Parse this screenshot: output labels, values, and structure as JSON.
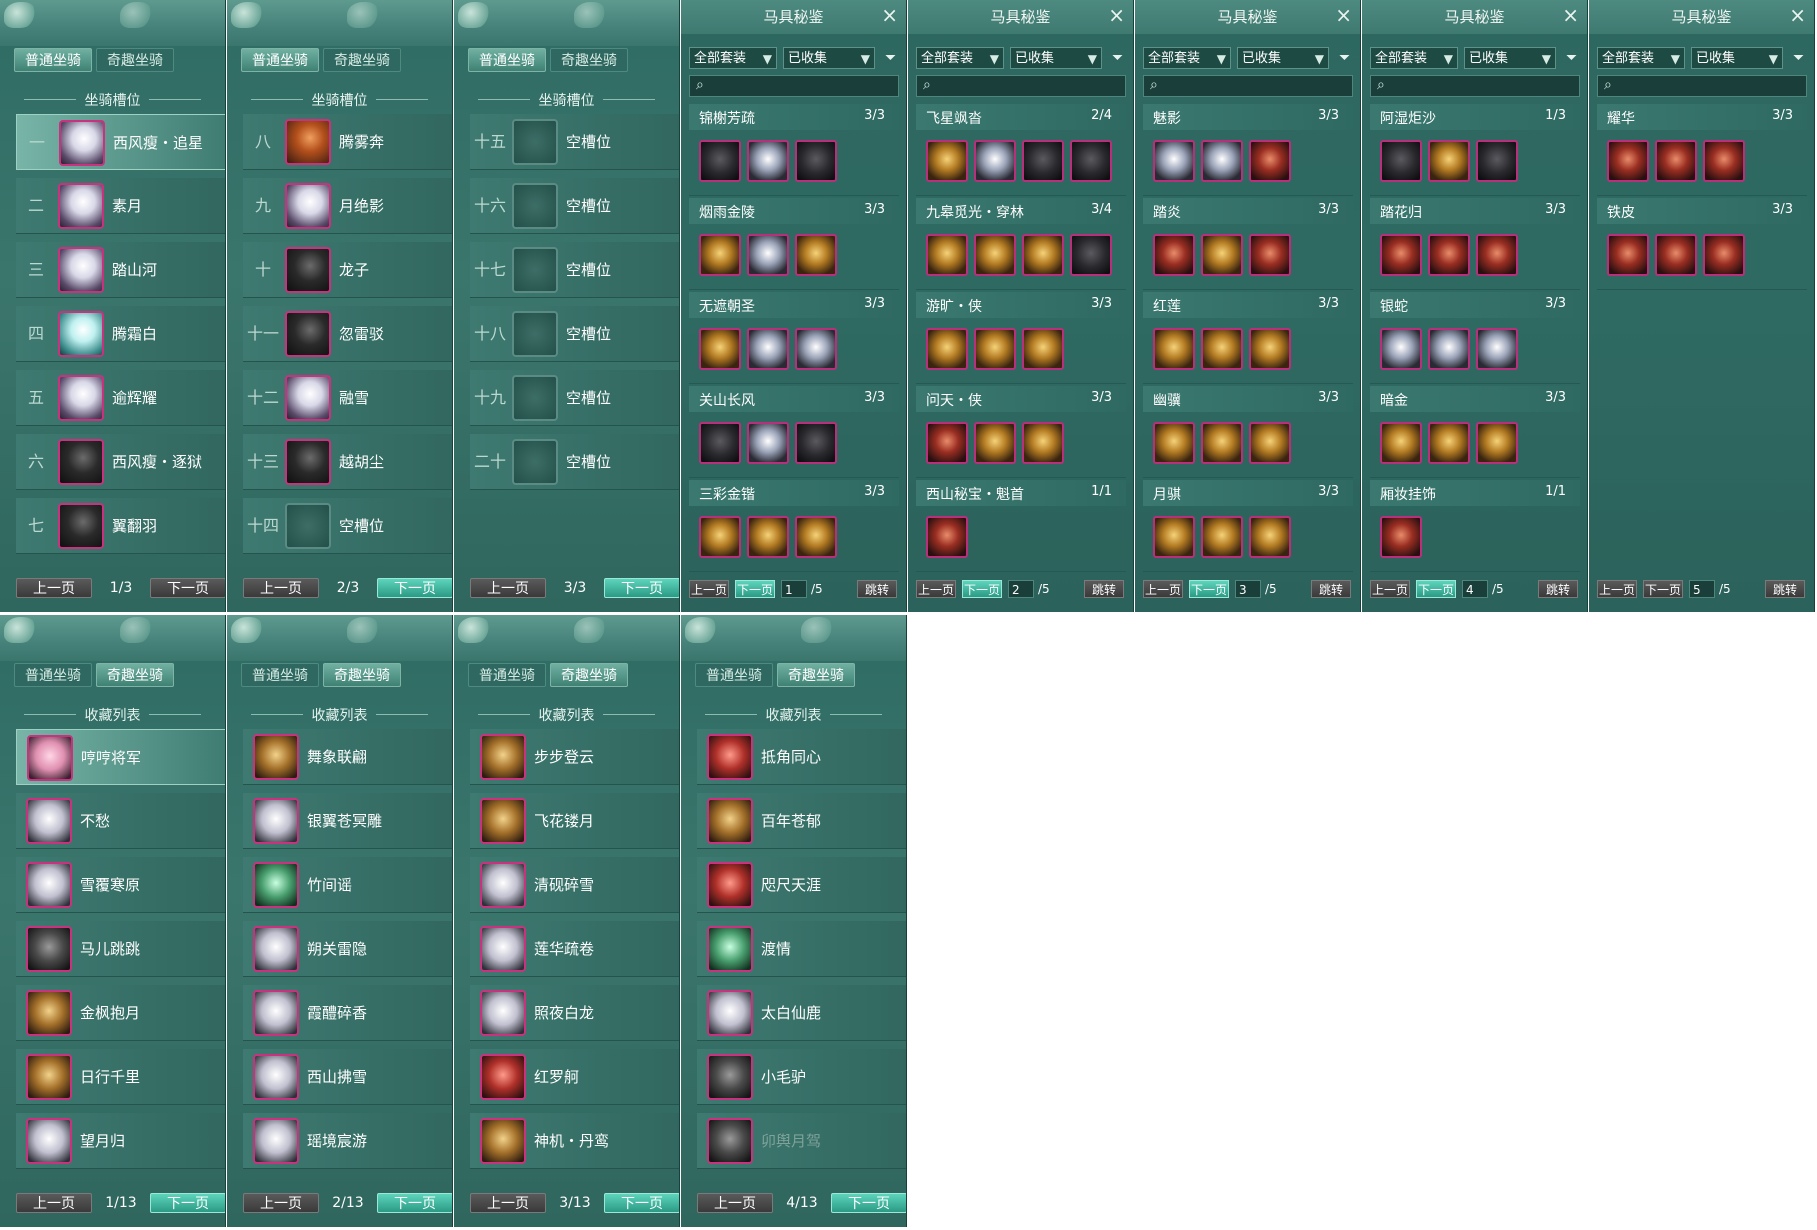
{
  "mount_tabs": {
    "normal": "普通坐骑",
    "fun": "奇趣坐骑"
  },
  "slots_title": "坐骑槽位",
  "collect_title": "收藏列表",
  "pager": {
    "prev": "上一页",
    "next": "下一页"
  },
  "mount_pages": [
    {
      "page": "1/3",
      "slots": [
        {
          "num": "一",
          "name": "西风瘦・追星",
          "thumb": "white",
          "selected": true
        },
        {
          "num": "二",
          "name": "素月",
          "thumb": "white"
        },
        {
          "num": "三",
          "name": "踏山河",
          "thumb": "white"
        },
        {
          "num": "四",
          "name": "腾霜白",
          "thumb": "cyan"
        },
        {
          "num": "五",
          "name": "逾辉耀",
          "thumb": "white"
        },
        {
          "num": "六",
          "name": "西风瘦・逐狱",
          "thumb": "dark"
        },
        {
          "num": "七",
          "name": "翼翻羽",
          "thumb": "dark"
        }
      ]
    },
    {
      "page": "2/3",
      "slots": [
        {
          "num": "八",
          "name": "腾雾奔",
          "thumb": "red"
        },
        {
          "num": "九",
          "name": "月绝影",
          "thumb": "white"
        },
        {
          "num": "十",
          "name": "龙子",
          "thumb": "dark"
        },
        {
          "num": "十一",
          "name": "忽雷驳",
          "thumb": "dark"
        },
        {
          "num": "十二",
          "name": "融雪",
          "thumb": "white"
        },
        {
          "num": "十三",
          "name": "越胡尘",
          "thumb": "dark"
        },
        {
          "num": "十四",
          "name": "空槽位",
          "thumb": "empty"
        }
      ]
    },
    {
      "page": "3/3",
      "slots": [
        {
          "num": "十五",
          "name": "空槽位",
          "thumb": "empty"
        },
        {
          "num": "十六",
          "name": "空槽位",
          "thumb": "empty"
        },
        {
          "num": "十七",
          "name": "空槽位",
          "thumb": "empty"
        },
        {
          "num": "十八",
          "name": "空槽位",
          "thumb": "empty"
        },
        {
          "num": "十九",
          "name": "空槽位",
          "thumb": "empty"
        },
        {
          "num": "二十",
          "name": "空槽位",
          "thumb": "empty"
        }
      ]
    }
  ],
  "collection": {
    "title": "马具秘鉴",
    "close": "×",
    "filter_all": "全部套装",
    "filter_collected": "已收集",
    "jump": "跳转",
    "total": "/5",
    "pages": [
      {
        "page": "1",
        "sets": [
          {
            "name": "锦榭芳疏",
            "count": "3/3",
            "pieces": [
              "dark",
              "silver",
              "dark"
            ]
          },
          {
            "name": "烟雨金陵",
            "count": "3/3",
            "pieces": [
              "gold",
              "silver",
              "gold"
            ]
          },
          {
            "name": "无遮朝圣",
            "count": "3/3",
            "pieces": [
              "gold",
              "silver",
              "silver"
            ]
          },
          {
            "name": "关山长风",
            "count": "3/3",
            "pieces": [
              "dark",
              "silver",
              "dark"
            ]
          },
          {
            "name": "三彩金锴",
            "count": "3/3",
            "pieces": [
              "gold",
              "gold",
              "gold"
            ]
          }
        ]
      },
      {
        "page": "2",
        "sets": [
          {
            "name": "飞星飒沓",
            "count": "2/4",
            "pieces": [
              "gold",
              "silver",
              "dark",
              "dark"
            ]
          },
          {
            "name": "九皋觅光・穿林",
            "count": "3/4",
            "pieces": [
              "gold",
              "gold",
              "gold",
              "dark"
            ]
          },
          {
            "name": "游旷・侠",
            "count": "3/3",
            "pieces": [
              "gold",
              "gold",
              "gold"
            ]
          },
          {
            "name": "问天・侠",
            "count": "3/3",
            "pieces": [
              "red",
              "gold",
              "gold"
            ]
          },
          {
            "name": "西山秘宝・魁首",
            "count": "1/1",
            "pieces": [
              "red"
            ]
          }
        ]
      },
      {
        "page": "3",
        "sets": [
          {
            "name": "魅影",
            "count": "3/3",
            "pieces": [
              "silver",
              "silver",
              "red"
            ]
          },
          {
            "name": "踏炎",
            "count": "3/3",
            "pieces": [
              "red",
              "gold",
              "red"
            ]
          },
          {
            "name": "红莲",
            "count": "3/3",
            "pieces": [
              "gold",
              "gold",
              "gold"
            ]
          },
          {
            "name": "幽骥",
            "count": "3/3",
            "pieces": [
              "gold",
              "gold",
              "gold"
            ]
          },
          {
            "name": "月骐",
            "count": "3/3",
            "pieces": [
              "gold",
              "gold",
              "gold"
            ]
          }
        ]
      },
      {
        "page": "4",
        "sets": [
          {
            "name": "阿湿炬沙",
            "count": "1/3",
            "pieces": [
              "dark",
              "gold",
              "dark"
            ]
          },
          {
            "name": "踏花归",
            "count": "3/3",
            "pieces": [
              "red",
              "red",
              "red"
            ]
          },
          {
            "name": "银蛇",
            "count": "3/3",
            "pieces": [
              "silver",
              "silver",
              "silver"
            ]
          },
          {
            "name": "暗金",
            "count": "3/3",
            "pieces": [
              "gold",
              "gold",
              "gold"
            ]
          },
          {
            "name": "厢妆挂饰",
            "count": "1/1",
            "pieces": [
              "red"
            ]
          }
        ]
      },
      {
        "page": "5",
        "sets": [
          {
            "name": "耀华",
            "count": "3/3",
            "pieces": [
              "red",
              "red",
              "red"
            ]
          },
          {
            "name": "铁皮",
            "count": "3/3",
            "pieces": [
              "red",
              "red",
              "red"
            ]
          }
        ]
      }
    ]
  },
  "fun_pages": [
    {
      "page": "1/13",
      "items": [
        {
          "name": "哼哼将军",
          "thumb": "t1",
          "selected": true
        },
        {
          "name": "不愁",
          "thumb": "t2"
        },
        {
          "name": "雪覆寒原",
          "thumb": "t2"
        },
        {
          "name": "马儿跳跳",
          "thumb": "t6"
        },
        {
          "name": "金枫抱月",
          "thumb": "t3"
        },
        {
          "name": "日行千里",
          "thumb": "t3"
        },
        {
          "name": "望月归",
          "thumb": "t2"
        }
      ]
    },
    {
      "page": "2/13",
      "items": [
        {
          "name": "舞象联翩",
          "thumb": "t3"
        },
        {
          "name": "银翼苍冥雕",
          "thumb": "t2"
        },
        {
          "name": "竹间谣",
          "thumb": "t4"
        },
        {
          "name": "朔关雷隐",
          "thumb": "t2"
        },
        {
          "name": "霞醴碎香",
          "thumb": "t2"
        },
        {
          "name": "西山拂雪",
          "thumb": "t2"
        },
        {
          "name": "瑶境宸游",
          "thumb": "t2"
        }
      ]
    },
    {
      "page": "3/13",
      "items": [
        {
          "name": "步步登云",
          "thumb": "t3"
        },
        {
          "name": "飞花镂月",
          "thumb": "t3"
        },
        {
          "name": "清砚碎雪",
          "thumb": "t2"
        },
        {
          "name": "莲华疏卷",
          "thumb": "t2"
        },
        {
          "name": "照夜白龙",
          "thumb": "t2"
        },
        {
          "name": "红罗舸",
          "thumb": "t5"
        },
        {
          "name": "神机・丹鸾",
          "thumb": "t3"
        }
      ]
    },
    {
      "page": "4/13",
      "items": [
        {
          "name": "抵角同心",
          "thumb": "t5"
        },
        {
          "name": "百年苍郁",
          "thumb": "t3"
        },
        {
          "name": "咫尺天涯",
          "thumb": "t5"
        },
        {
          "name": "渡情",
          "thumb": "t4"
        },
        {
          "name": "太白仙鹿",
          "thumb": "t2"
        },
        {
          "name": "小毛驴",
          "thumb": "t6"
        },
        {
          "name": "卯舆月驾",
          "thumb": "t6",
          "dim": true
        }
      ]
    }
  ]
}
